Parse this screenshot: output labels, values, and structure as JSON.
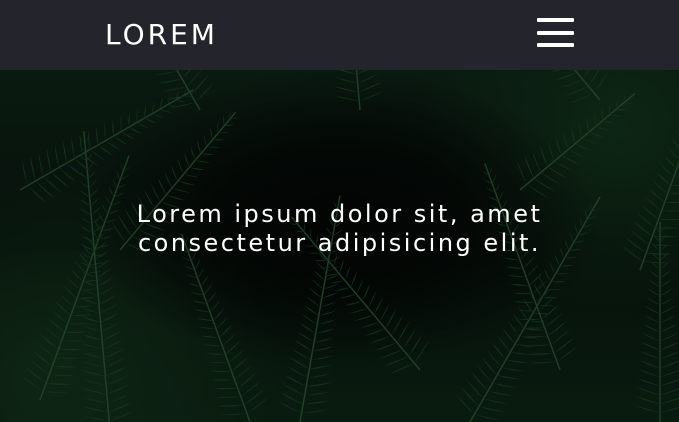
{
  "navbar": {
    "brand": "LOREM",
    "menu_icon": "hamburger-menu-icon"
  },
  "hero": {
    "background_image": "dark-green-fern-leaves",
    "line1": "Lorem ipsum dolor sit, amet",
    "line2": "consectetur adipisicing elit."
  },
  "colors": {
    "navbar_bg": "#24242c",
    "text": "#ffffff",
    "foliage": "#1d4a28"
  }
}
